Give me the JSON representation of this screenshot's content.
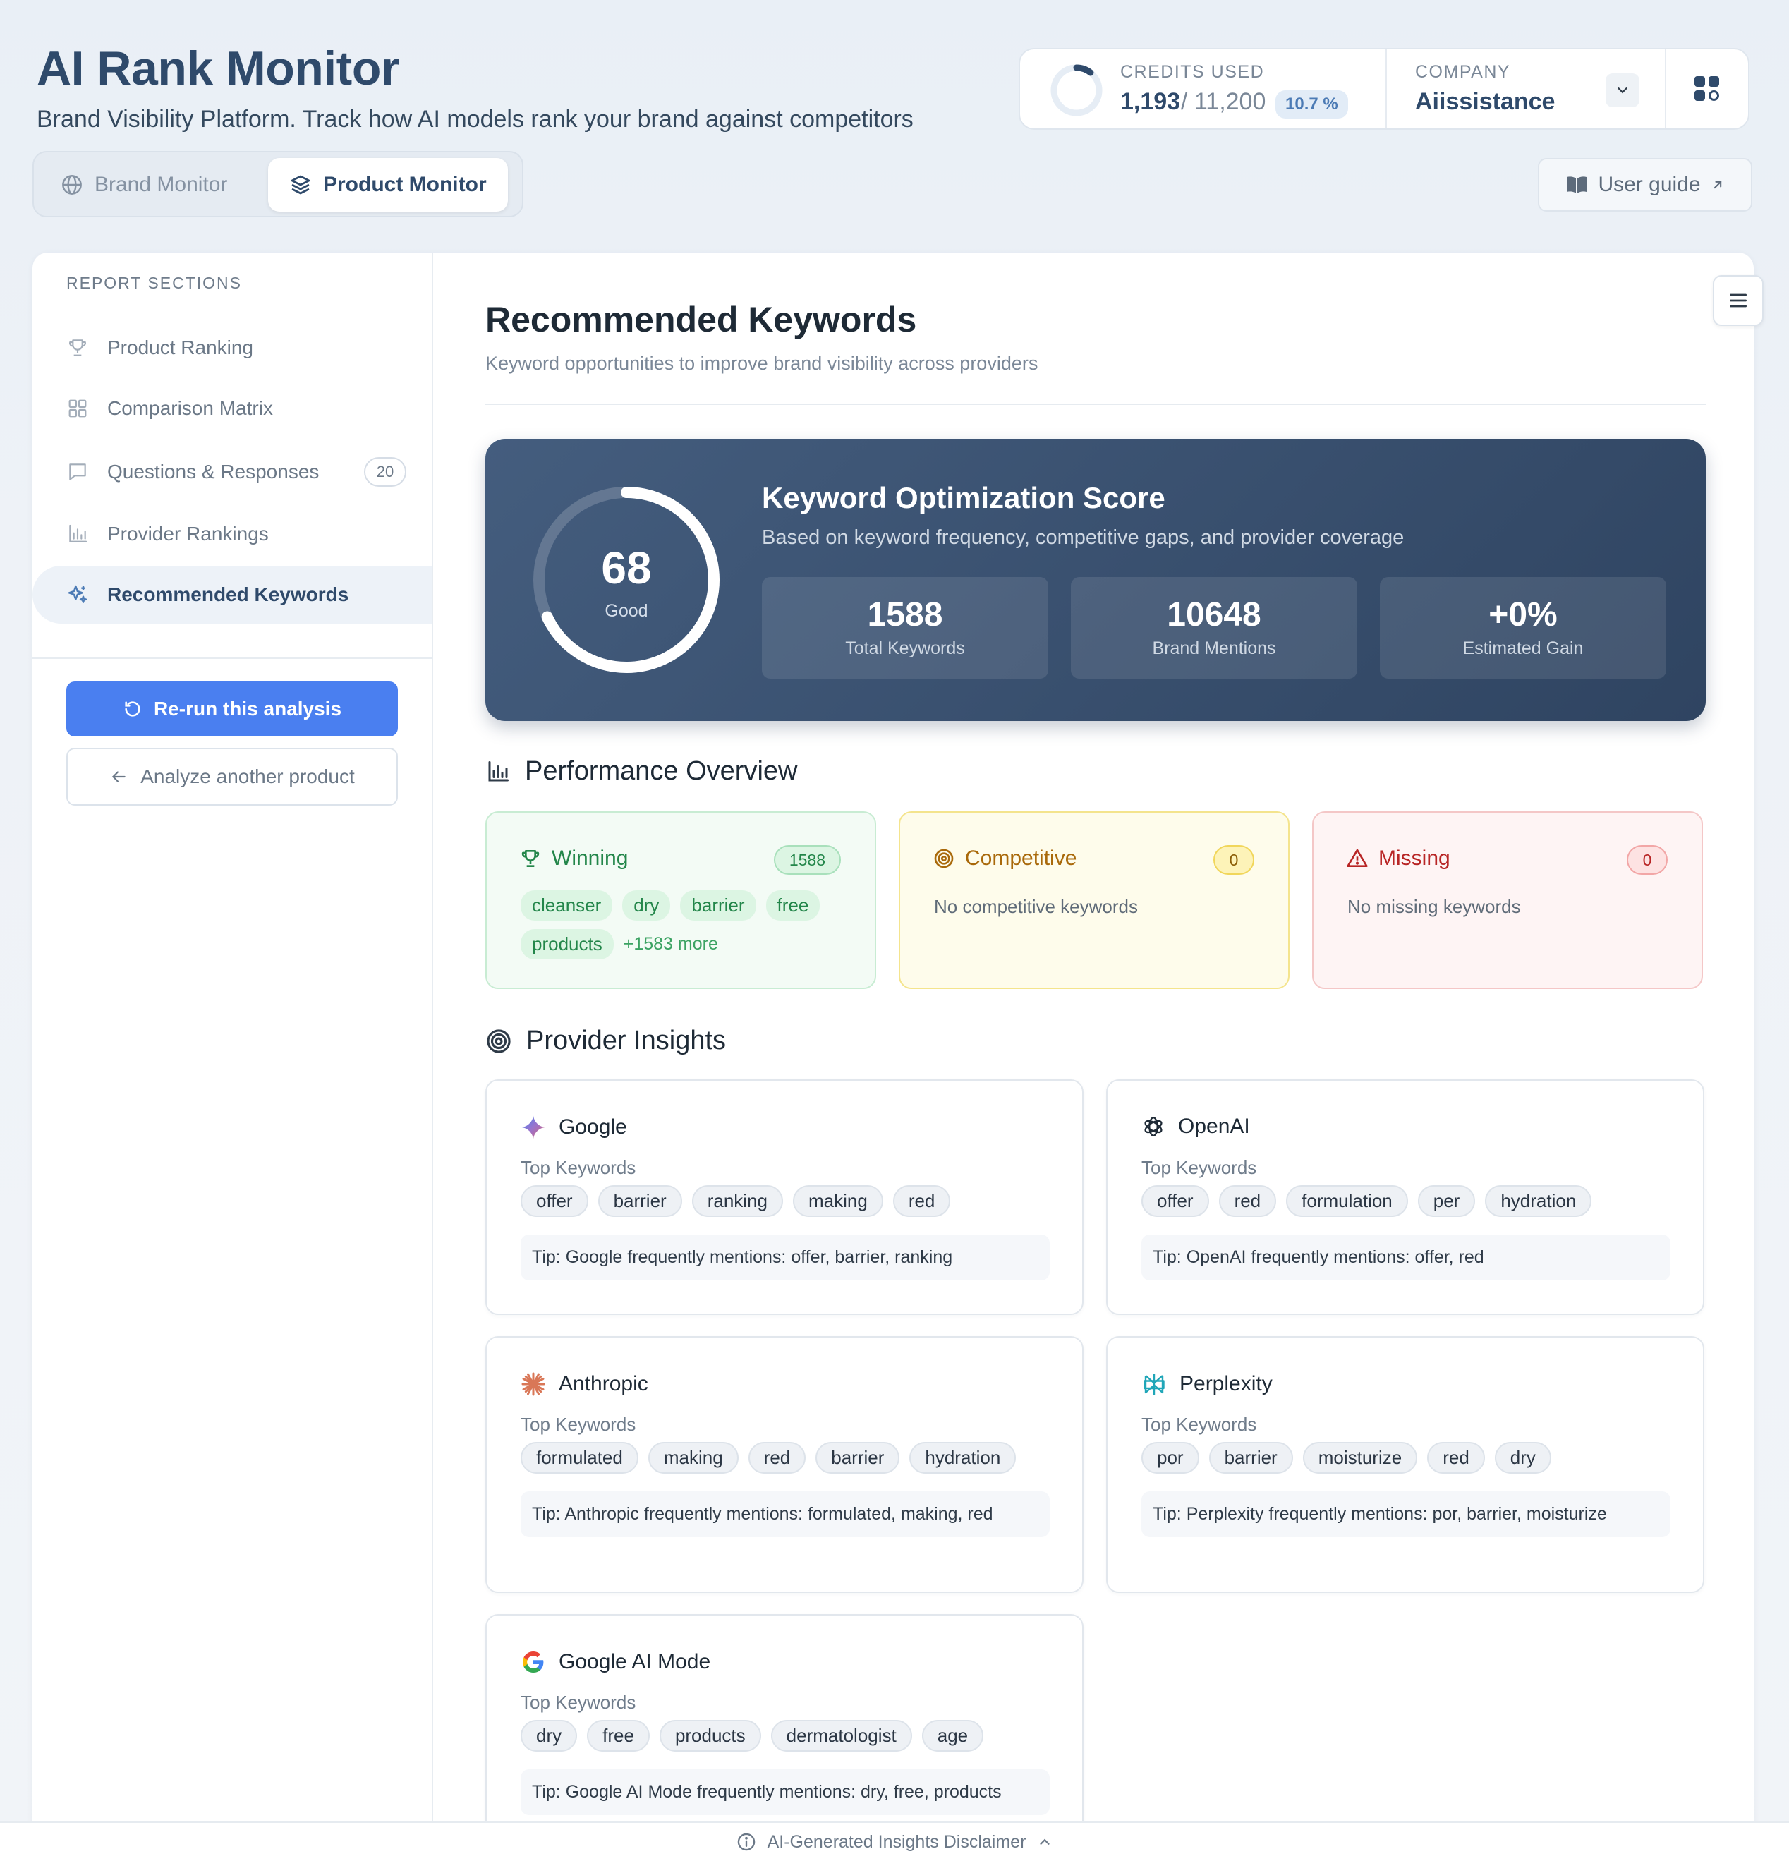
{
  "header": {
    "title": "AI Rank Monitor",
    "subtitle": "Brand Visibility Platform. Track how AI models rank your brand against competitors"
  },
  "credits": {
    "label": "CREDITS USED",
    "used": "1,193",
    "total": "/ 11,200",
    "percent_label": "10.7 %",
    "fraction": 0.107
  },
  "company": {
    "label": "COMPANY",
    "name": "Aiissistance"
  },
  "mode_tabs": {
    "brand": "Brand Monitor",
    "product": "Product Monitor",
    "active": "product"
  },
  "user_guide": "User guide",
  "sidebar": {
    "heading": "REPORT SECTIONS",
    "items": [
      {
        "label": "Product Ranking",
        "icon": "trophy-icon"
      },
      {
        "label": "Comparison Matrix",
        "icon": "grid-icon"
      },
      {
        "label": "Questions & Responses",
        "icon": "message-icon",
        "badge": "20"
      },
      {
        "label": "Provider Rankings",
        "icon": "bar-chart-icon"
      },
      {
        "label": "Recommended Keywords",
        "icon": "sparkles-icon",
        "active": true
      }
    ],
    "rerun": "Re-run this analysis",
    "analyze_another": "Analyze another product"
  },
  "main": {
    "title": "Recommended Keywords",
    "subtitle": "Keyword opportunities to improve brand visibility across providers"
  },
  "score": {
    "value": "68",
    "fraction": 0.68,
    "label": "Good",
    "title": "Keyword Optimization Score",
    "description": "Based on keyword frequency, competitive gaps, and provider coverage",
    "stats": [
      {
        "value": "1588",
        "label": "Total Keywords"
      },
      {
        "value": "10648",
        "label": "Brand Mentions"
      },
      {
        "value": "+0%",
        "label": "Estimated Gain"
      }
    ]
  },
  "performance": {
    "heading": "Performance Overview",
    "winning": {
      "title": "Winning",
      "count": "1588",
      "tags": [
        "cleanser",
        "dry",
        "barrier",
        "free",
        "products"
      ],
      "more": "+1583 more"
    },
    "competitive": {
      "title": "Competitive",
      "count": "0",
      "empty": "No competitive keywords"
    },
    "missing": {
      "title": "Missing",
      "count": "0",
      "empty": "No missing keywords"
    }
  },
  "providers": {
    "heading": "Provider Insights",
    "sub_label": "Top Keywords",
    "items": [
      {
        "name": "Google",
        "icon": "google-gemini-icon",
        "keywords": [
          "offer",
          "barrier",
          "ranking",
          "making",
          "red"
        ],
        "tip": "Tip: Google frequently mentions: offer, barrier, ranking"
      },
      {
        "name": "OpenAI",
        "icon": "openai-icon",
        "keywords": [
          "offer",
          "red",
          "formulation",
          "per",
          "hydration"
        ],
        "tip": "Tip: OpenAI frequently mentions: offer, red"
      },
      {
        "name": "Anthropic",
        "icon": "anthropic-icon",
        "keywords": [
          "formulated",
          "making",
          "red",
          "barrier",
          "hydration"
        ],
        "tip": "Tip: Anthropic frequently mentions: formulated, making, red"
      },
      {
        "name": "Perplexity",
        "icon": "perplexity-icon",
        "keywords": [
          "por",
          "barrier",
          "moisturize",
          "red",
          "dry"
        ],
        "tip": "Tip: Perplexity frequently mentions: por, barrier, moisturize"
      },
      {
        "name": "Google AI Mode",
        "icon": "google-g-icon",
        "keywords": [
          "dry",
          "free",
          "products",
          "dermatologist",
          "age"
        ],
        "tip": "Tip: Google AI Mode frequently mentions: dry, free, products"
      }
    ]
  },
  "footer": {
    "disclaimer": "AI-Generated Insights Disclaimer"
  },
  "colors": {
    "accent": "#4a7ff0",
    "brand_dark": "#2f4a6b",
    "winning": "#23864a",
    "competitive": "#a9690a",
    "missing": "#b82525"
  }
}
